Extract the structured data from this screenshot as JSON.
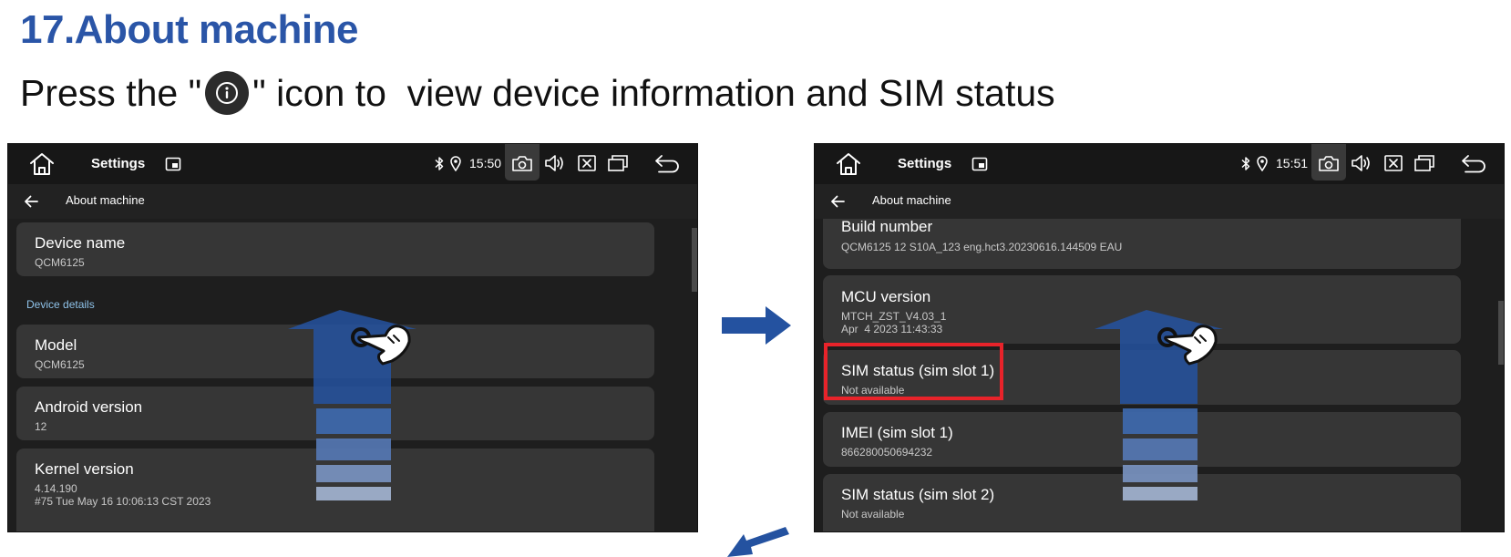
{
  "heading": "17.About machine",
  "instruction": {
    "before": "Press the \"",
    "after": "\" icon to  view device information and SIM status",
    "icon": "info-icon"
  },
  "colors": {
    "heading": "#2a55a7",
    "screen_bg": "#1e1e1e",
    "card_bg": "#363636",
    "section_label": "#8fc3ea",
    "highlight": "#e8232a",
    "gesture_arrow": "#2452a0"
  },
  "left_screen": {
    "status_bar": {
      "title": "Settings",
      "time": "15:50",
      "icons": [
        "home-icon",
        "floating-window-icon",
        "bluetooth-icon",
        "location-icon",
        "screenshot-icon",
        "volume-icon",
        "close-app-icon",
        "window-switch-icon",
        "back-icon"
      ]
    },
    "app_bar": {
      "title": "About machine"
    },
    "section_label": "Device details",
    "items": [
      {
        "title": "Device name",
        "subtitle": "QCM6125"
      },
      {
        "title": "Model",
        "subtitle": "QCM6125"
      },
      {
        "title": "Android version",
        "subtitle": "12"
      },
      {
        "title": "Kernel version",
        "subtitle": "4.14.190\n#75 Tue May 16 10:06:13 CST 2023"
      }
    ]
  },
  "right_screen": {
    "status_bar": {
      "title": "Settings",
      "time": "15:51",
      "icons": [
        "home-icon",
        "floating-window-icon",
        "bluetooth-icon",
        "location-icon",
        "screenshot-icon",
        "volume-icon",
        "close-app-icon",
        "window-switch-icon",
        "back-icon"
      ]
    },
    "app_bar": {
      "title": "About machine"
    },
    "items": [
      {
        "title": "Build number",
        "subtitle": "QCM6125 12 S10A_123 eng.hct3.20230616.144509 EAU"
      },
      {
        "title": "MCU version",
        "subtitle": "MTCH_ZST_V4.03_1\nApr  4 2023 11:43:33"
      },
      {
        "title": "SIM status (sim slot 1)",
        "subtitle": "Not available",
        "highlighted": true
      },
      {
        "title": "IMEI (sim slot 1)",
        "subtitle": "866280050694232"
      },
      {
        "title": "SIM status (sim slot 2)",
        "subtitle": "Not available"
      }
    ]
  },
  "annotations": [
    "swipe-up-gesture-icon",
    "next-step-arrow-icon",
    "continue-arrow-icon"
  ]
}
